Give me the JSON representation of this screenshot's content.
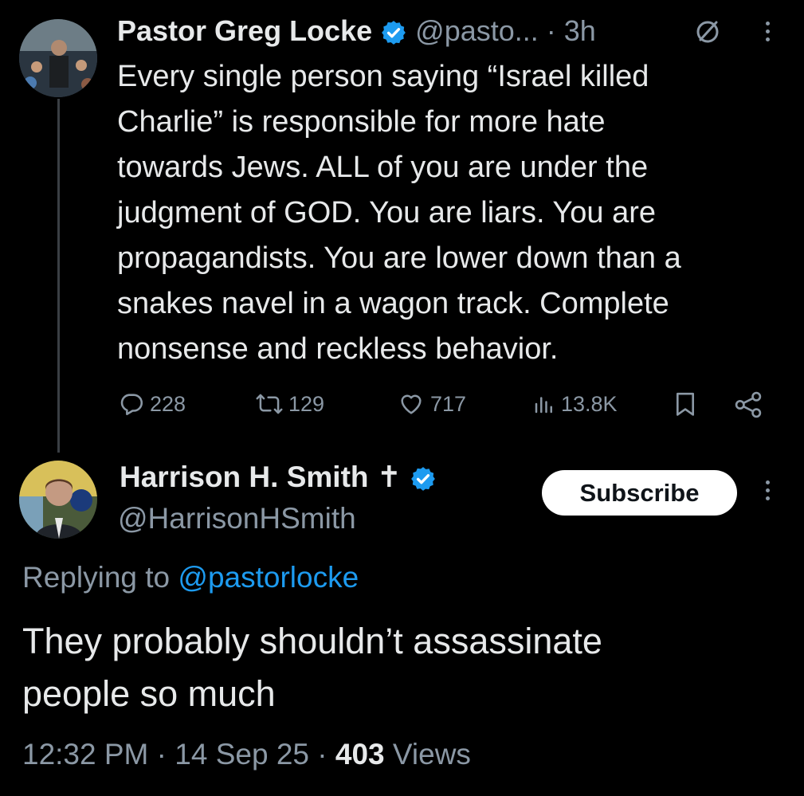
{
  "tweet": {
    "author_name": "Pastor Greg Locke",
    "author_handle": "@pasto...",
    "time": "· 3h",
    "body_lines": [
      "Every single person saying “Israel killed",
      "Charlie” is responsible for more hate",
      "towards Jews. ALL of you are under the",
      "judgment of GOD. You are liars. You are",
      "propagandists. You are lower down than a",
      "snakes navel in a wagon track. Complete",
      "nonsense and reckless behavior."
    ],
    "replies": "228",
    "reposts": "129",
    "likes": "717",
    "views": "13.8K"
  },
  "reply": {
    "author_name": "Harrison H. Smith",
    "author_suffix": "✝",
    "author_handle": "@HarrisonHSmith",
    "subscribe_label": "Subscribe",
    "replying_prefix": "Replying to",
    "replying_handle": "@pastorlocke",
    "body_lines": [
      "They probably shouldn’t assassinate",
      "people so much"
    ],
    "time": "12:32 PM",
    "date": "14 Sep 25",
    "sep": "·",
    "views_count": "403",
    "views_label": "Views"
  },
  "colors": {
    "background": "#000000",
    "text": "#e7e9ea",
    "muted": "#8b98a5",
    "link": "#1d9bf0",
    "verified": "#1d9bf0"
  }
}
